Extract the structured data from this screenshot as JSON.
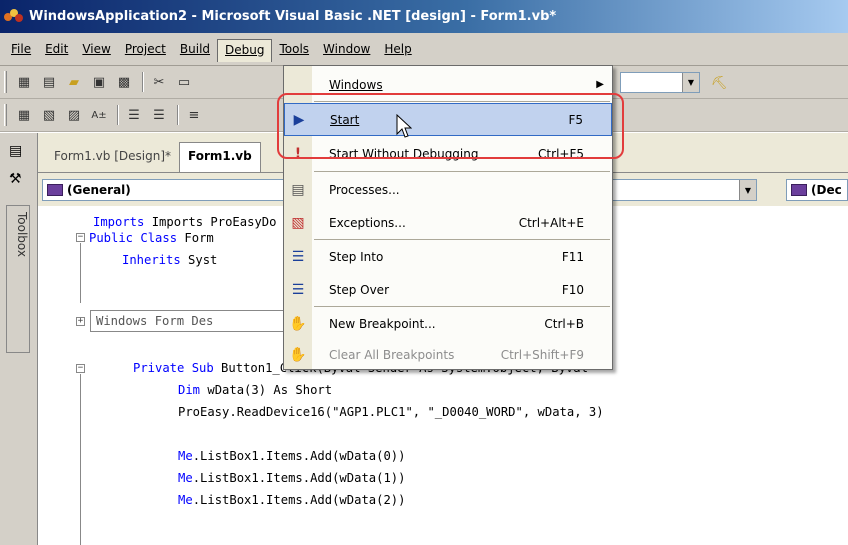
{
  "window": {
    "title": "WindowsApplication2 - Microsoft Visual Basic .NET [design] - Form1.vb*"
  },
  "menubar": {
    "items": [
      {
        "label": "File"
      },
      {
        "label": "Edit"
      },
      {
        "label": "View"
      },
      {
        "label": "Project"
      },
      {
        "label": "Build"
      },
      {
        "label": "Debug"
      },
      {
        "label": "Tools"
      },
      {
        "label": "Window"
      },
      {
        "label": "Help"
      }
    ]
  },
  "toolbox": {
    "label": "Toolbox"
  },
  "tabs": [
    {
      "label": "Form1.vb [Design]*"
    },
    {
      "label": "Form1.vb"
    }
  ],
  "editor": {
    "left_dropdown": "(General)",
    "right_dropdown": "(Dec",
    "lines": [
      {
        "text": "Imports ProEasyDo"
      },
      {
        "kw": "Public Class",
        "text": " Form"
      },
      {
        "kw": "Inherits",
        "text": " Syst"
      },
      {
        "text": "Windows Form Des"
      },
      {
        "kw": "Private Sub",
        "text": " Button1_Click(ByVal Sender As System.Object, ByVal"
      },
      {
        "kw": "Dim",
        "text": " wData(3) As Short"
      },
      {
        "text": "ProEasy.ReadDevice16(\"AGP1.PLC1\", \"_D0040_WORD\", wData, 3)"
      },
      {
        "kw": "Me",
        "text": ".ListBox1.Items.Add(wData(0))"
      },
      {
        "kw": "Me",
        "text": ".ListBox1.Items.Add(wData(1))"
      },
      {
        "kw": "Me",
        "text": ".ListBox1.Items.Add(wData(2))"
      }
    ]
  },
  "debug_menu": {
    "items": [
      {
        "label": "Windows",
        "shortcut": "",
        "submenu": true,
        "icon": "windows-icon"
      },
      {
        "label": "Start",
        "shortcut": "F5",
        "icon": "play-icon"
      },
      {
        "label": "Start Without Debugging",
        "shortcut": "Ctrl+F5",
        "icon": "exclamation-icon"
      },
      {
        "label": "Processes...",
        "shortcut": "",
        "icon": "processes-icon"
      },
      {
        "label": "Exceptions...",
        "shortcut": "Ctrl+Alt+E",
        "icon": "exceptions-icon"
      },
      {
        "label": "Step Into",
        "shortcut": "F11",
        "icon": "step-into-icon"
      },
      {
        "label": "Step Over",
        "shortcut": "F10",
        "icon": "step-over-icon"
      },
      {
        "label": "New Breakpoint...",
        "shortcut": "Ctrl+B",
        "icon": "breakpoint-icon"
      },
      {
        "label": "Clear All Breakpoints",
        "shortcut": "Ctrl+Shift+F9",
        "icon": "clear-breakpoints-icon"
      }
    ]
  },
  "colors": {
    "keyword": "#0000ff",
    "highlight_ring": "#e23c3c",
    "menu_highlight": "#c1d2ee"
  }
}
